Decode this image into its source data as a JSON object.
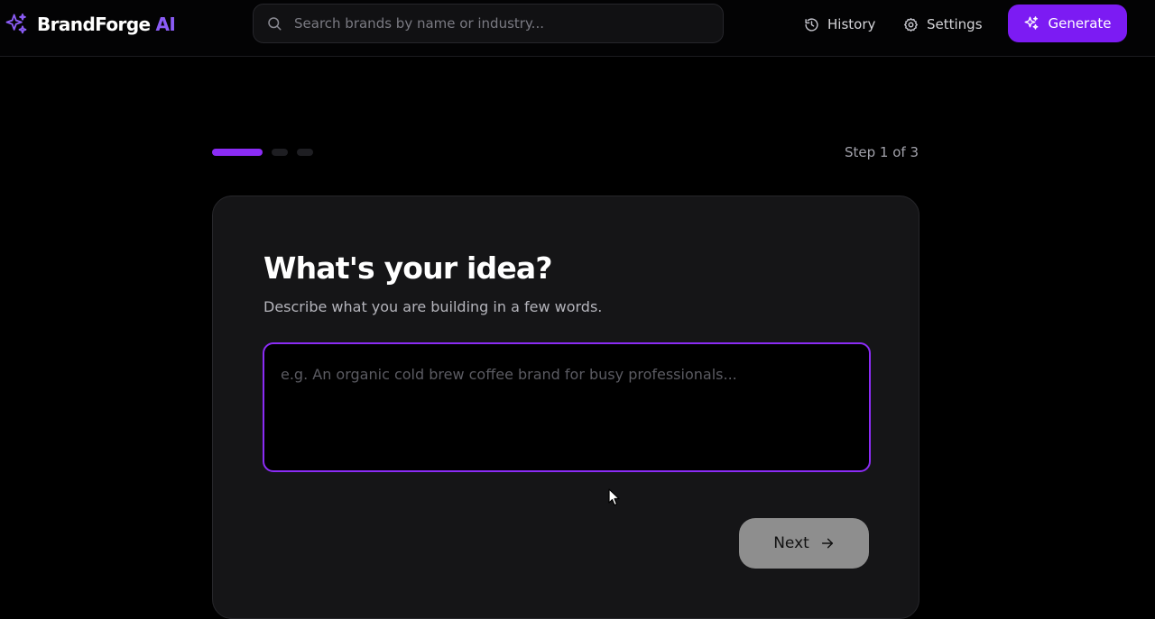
{
  "header": {
    "brand_name": "BrandForge",
    "brand_accent": "AI",
    "search_placeholder": "Search brands by name or industry...",
    "nav": {
      "history": "History",
      "settings": "Settings"
    },
    "generate_label": "Generate"
  },
  "wizard": {
    "step_label": "Step 1 of 3",
    "current_step": 1,
    "total_steps": 3,
    "title": "What's your idea?",
    "subtitle": "Describe what you are building in a few words.",
    "idea_placeholder": "e.g. An organic cold brew coffee brand for busy professionals...",
    "idea_value": "",
    "next_label": "Next"
  },
  "icons": {
    "brand": "sparkles-icon",
    "search": "search-icon",
    "history": "history-icon",
    "settings": "gear-icon",
    "generate": "sparkles-icon",
    "next": "arrow-right-icon"
  },
  "colors": {
    "accent": "#8b2cf5",
    "generate_bg": "#7c1bf3",
    "background": "#000000",
    "card_bg": "#151517",
    "next_bg": "#8e8e8e"
  }
}
